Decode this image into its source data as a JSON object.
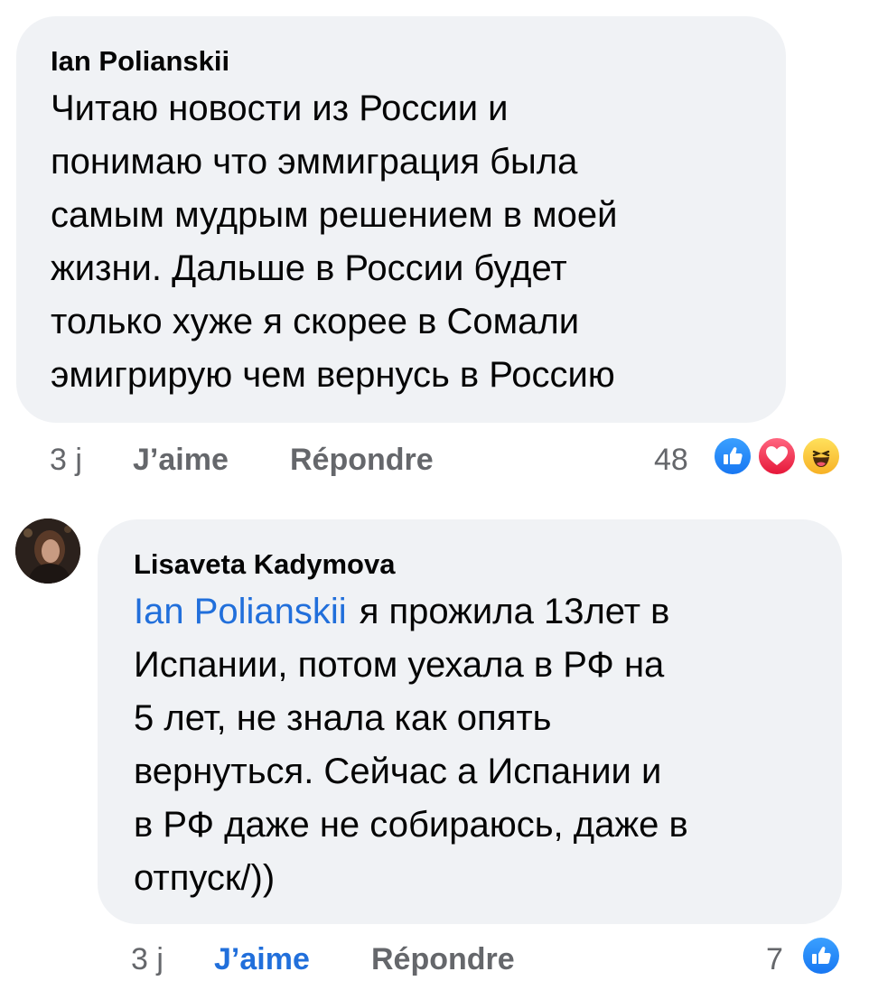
{
  "comment1": {
    "author": "Ian Polianskii",
    "text": "Читаю новости из России и\nпонимаю что эммиграция была\nсамым мудрым решением в моей\nжизни. Дальше в России будет\nтолько хуже я скорее в Сомали\nэмигрирую чем вернусь в Россию",
    "time": "3 j",
    "like_label": "J’aime",
    "reply_label": "Répondre",
    "reaction_count": "48",
    "reactions": [
      "like-icon",
      "love-icon",
      "haha-icon"
    ]
  },
  "comment2": {
    "author": "Lisaveta Kadymova",
    "mention": "Ian Polianskii",
    "text": "я прожила 13лет в\nИспании, потом уехала в РФ на\n5 лет, не знала как опять\nвернуться. Сейчас а Испании и\nв РФ даже не собираюсь, даже в\nотпуск/))",
    "time": "3 j",
    "like_label": "J’aime",
    "reply_label": "Répondre",
    "reaction_count": "7",
    "reactions": [
      "like-icon"
    ],
    "liked": true
  },
  "colors": {
    "bubble": "#f0f2f5",
    "link": "#216fdb",
    "secondary_text": "#65676b"
  }
}
